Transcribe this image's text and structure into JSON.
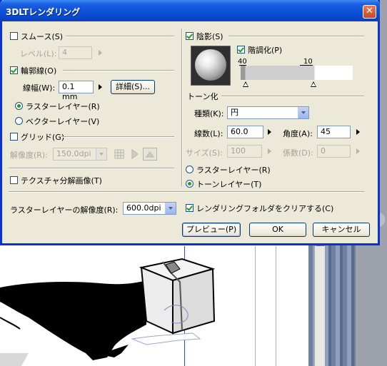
{
  "dialog": {
    "title": "3DLTレンダリング",
    "close_symbol": "✕"
  },
  "smooth": {
    "label": "スムース(S)",
    "checked": false,
    "level_label": "レベル(L):",
    "level_value": "4"
  },
  "outline": {
    "label": "輪郭線(O)",
    "checked": true,
    "width_label": "線幅(W):",
    "width_value": "0.1 mm",
    "detail_button": "詳細(S)...",
    "raster_label": "ラスターレイヤー(R)",
    "raster_selected": true,
    "vector_label": "ベクターレイヤー(V)",
    "vector_selected": false
  },
  "grid": {
    "label": "グリッド(G)",
    "checked": false,
    "resolution_label": "解像度(R):",
    "resolution_value": "150.0dpi"
  },
  "texture": {
    "label": "テクスチャ分解画像(T)",
    "checked": false
  },
  "raster_resolution": {
    "label": "ラスターレイヤーの解像度(R):",
    "value": "600.0dpi"
  },
  "shadow": {
    "label": "陰影(S)",
    "checked": true,
    "gradation_label": "階調化(P)",
    "gradation_checked": true,
    "marker_left_value": "40",
    "marker_right_value": "10"
  },
  "tone": {
    "section_label": "トーン化",
    "type_label": "種類(K):",
    "type_value": "円",
    "lines_label": "線数(L):",
    "lines_value": "60.0",
    "angle_label": "角度(A):",
    "angle_value": "45",
    "size_label": "サイズ(S):",
    "size_value": "100",
    "coef_label": "係数(D):",
    "coef_value": "0",
    "raster_label": "ラスターレイヤー(R)",
    "raster_selected": false,
    "tone_layer_label": "トーンレイヤー(T)",
    "tone_layer_selected": true
  },
  "clear_folder": {
    "label": "レンダリングフォルダをクリアする(C)",
    "checked": true
  },
  "buttons": {
    "preview": "プレビュー(P)",
    "ok": "OK",
    "cancel": "キャンセル"
  },
  "colors": {
    "title_bar": "#0a4fd6",
    "dialog_bg": "#ece9d8",
    "check_mark": "#21a121"
  }
}
